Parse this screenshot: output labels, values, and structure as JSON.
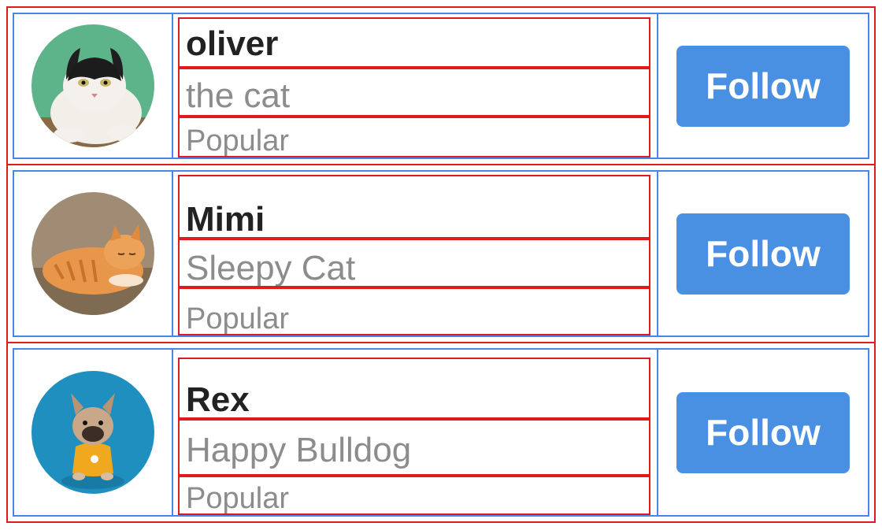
{
  "users": [
    {
      "name": "oliver",
      "subtitle": "the cat",
      "badge": "Popular",
      "follow_label": "Follow",
      "avatar_icon": "black-white-cat-avatar"
    },
    {
      "name": "Mimi",
      "subtitle": "Sleepy Cat",
      "badge": "Popular",
      "follow_label": "Follow",
      "avatar_icon": "orange-tabby-cat-avatar"
    },
    {
      "name": "Rex",
      "subtitle": "Happy Bulldog",
      "badge": "Popular",
      "follow_label": "Follow",
      "avatar_icon": "french-bulldog-avatar"
    }
  ],
  "colors": {
    "follow_button": "#4a90e2",
    "outline_red": "#e01b1b",
    "outline_blue": "#4a86e8"
  }
}
